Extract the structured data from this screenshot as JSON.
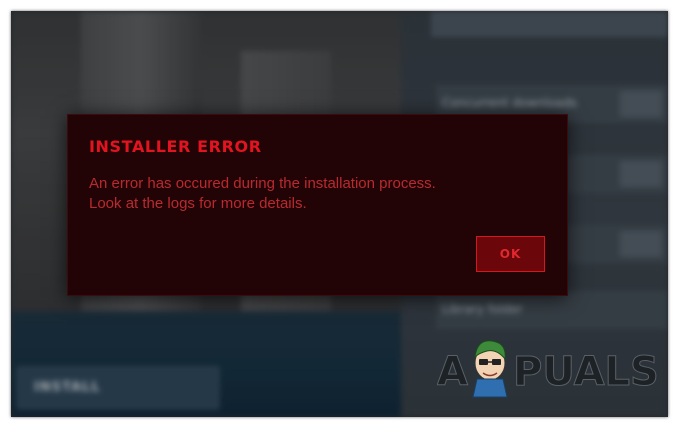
{
  "background": {
    "install_button_label": "INSTALL",
    "settings_rows": [
      "Concurrent downloads",
      "",
      "",
      "Library folder"
    ]
  },
  "dialog": {
    "title": "INSTALLER ERROR",
    "message_lines": [
      "An error has occured during the installation process.",
      "Look at the logs for more details."
    ],
    "ok_label": "OK"
  },
  "watermark": {
    "text": "APPUALS"
  },
  "colors": {
    "dialog_bg": "#220406",
    "title_red": "#e3141f",
    "message_red": "#b92a30",
    "button_bg": "#6b060b",
    "button_border": "#d31822"
  },
  "icons": {
    "watermark_mascot": "appuals-mascot-icon"
  }
}
